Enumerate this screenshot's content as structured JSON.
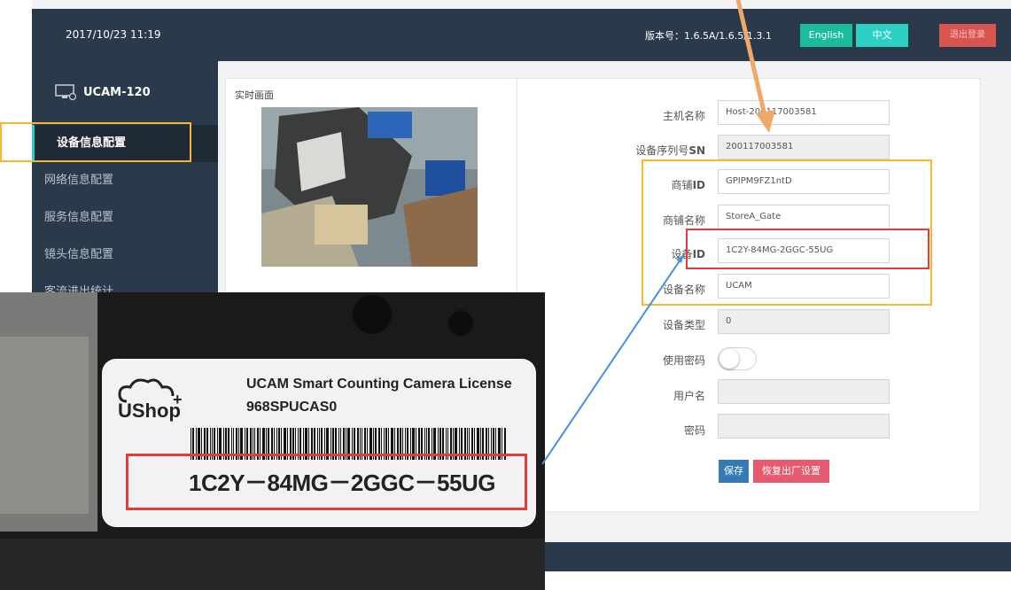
{
  "header": {
    "datetime": "2017/10/23 11:19",
    "version": "版本号：1.6.5A/1.6.5/1.3.1",
    "english_label": "English",
    "chinese_label": "中文",
    "logout_label": "退出登录"
  },
  "sidebar": {
    "device_name": "UCAM-120",
    "items": [
      {
        "label": "设备信息配置"
      },
      {
        "label": "网络信息配置"
      },
      {
        "label": "服务信息配置"
      },
      {
        "label": "镜头信息配置"
      },
      {
        "label": "客流进出统计"
      }
    ]
  },
  "live": {
    "title": "实时画面"
  },
  "form": {
    "rows": [
      {
        "label": "主机名称",
        "value": "Host-200117003581"
      },
      {
        "label": "设备序列号",
        "label_bold": "SN",
        "value": "200117003581"
      },
      {
        "label": "商铺",
        "label_bold": "ID",
        "value": "GPIPM9FZ1ntD"
      },
      {
        "label": "商铺名称",
        "value": "StoreA_Gate"
      },
      {
        "label": "设备",
        "label_bold": "ID",
        "value": "1C2Y-84MG-2GGC-55UG"
      },
      {
        "label": "设备名称",
        "value": "UCAM"
      },
      {
        "label": "设备类型",
        "value": "0"
      },
      {
        "label": "使用密码",
        "value": ""
      },
      {
        "label": "用户名",
        "value": ""
      },
      {
        "label": "密码",
        "value": ""
      }
    ],
    "save_label": "保存",
    "reset_label": "恢复出厂设置",
    "password_enabled": false
  },
  "license_label": {
    "brand": "UShop",
    "brand_mark": "+",
    "title": "UCAM Smart Counting Camera License",
    "sku": "968SPUCAS0",
    "device_id": "1C2Y－84MG－2GGC－55UG"
  },
  "colors": {
    "nav_bg": "#2b3a4a",
    "accent_teal": "#1abc9c",
    "highlight_orange": "#f7b733",
    "highlight_red": "#e23b3b",
    "connector_blue": "#4a90d9",
    "arrow_orange": "#f0a868"
  }
}
